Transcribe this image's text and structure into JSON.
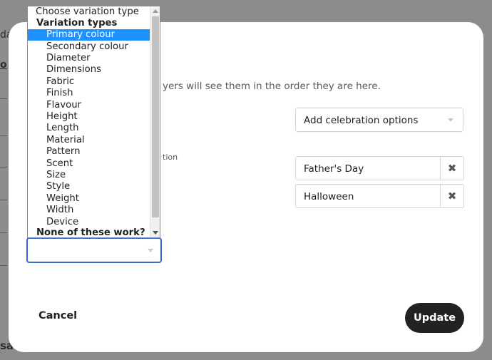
{
  "background": {
    "fragments": [
      "da",
      "o"
    ],
    "bottom_text": "sa"
  },
  "modal": {
    "description": "yers will see them in the order they are here.",
    "hint": "tion",
    "celebration_select": {
      "label": "Add celebration options"
    },
    "tags": [
      {
        "label": "Father's Day",
        "remove_icon": "close-icon"
      },
      {
        "label": "Halloween",
        "remove_icon": "close-icon"
      }
    ],
    "variation_select": {
      "value": ""
    },
    "cancel_label": "Cancel",
    "update_label": "Update"
  },
  "dropdown": {
    "placeholder": "Choose variation type",
    "group_label": "Variation types",
    "options": [
      "Primary colour",
      "Secondary colour",
      "Diameter",
      "Dimensions",
      "Fabric",
      "Finish",
      "Flavour",
      "Height",
      "Length",
      "Material",
      "Pattern",
      "Scent",
      "Size",
      "Style",
      "Weight",
      "Width",
      "Device"
    ],
    "selected": "Primary colour",
    "footer_group": "None of these work?"
  },
  "colors": {
    "selected_highlight": "#1e90ff",
    "focus_border": "#3b67c8",
    "primary_button": "#222222"
  }
}
